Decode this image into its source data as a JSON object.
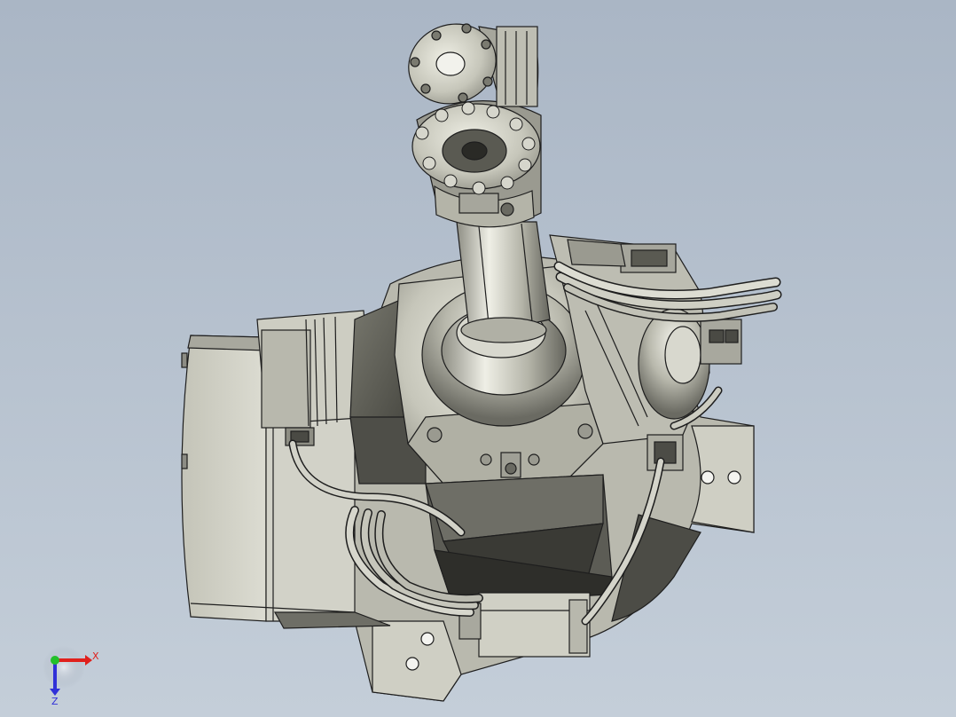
{
  "viewport": {
    "background_top": "#aab6c5",
    "background_bottom": "#c4ced9"
  },
  "model": {
    "body_color": "#c8c8bd",
    "shadow_color": "#5a5a52",
    "edge_color": "#1e1e1e"
  },
  "triad": {
    "x_label": "X",
    "z_label": "Z",
    "x_color": "#e0201c",
    "y_color": "#22c02a",
    "z_color": "#3030d8"
  }
}
